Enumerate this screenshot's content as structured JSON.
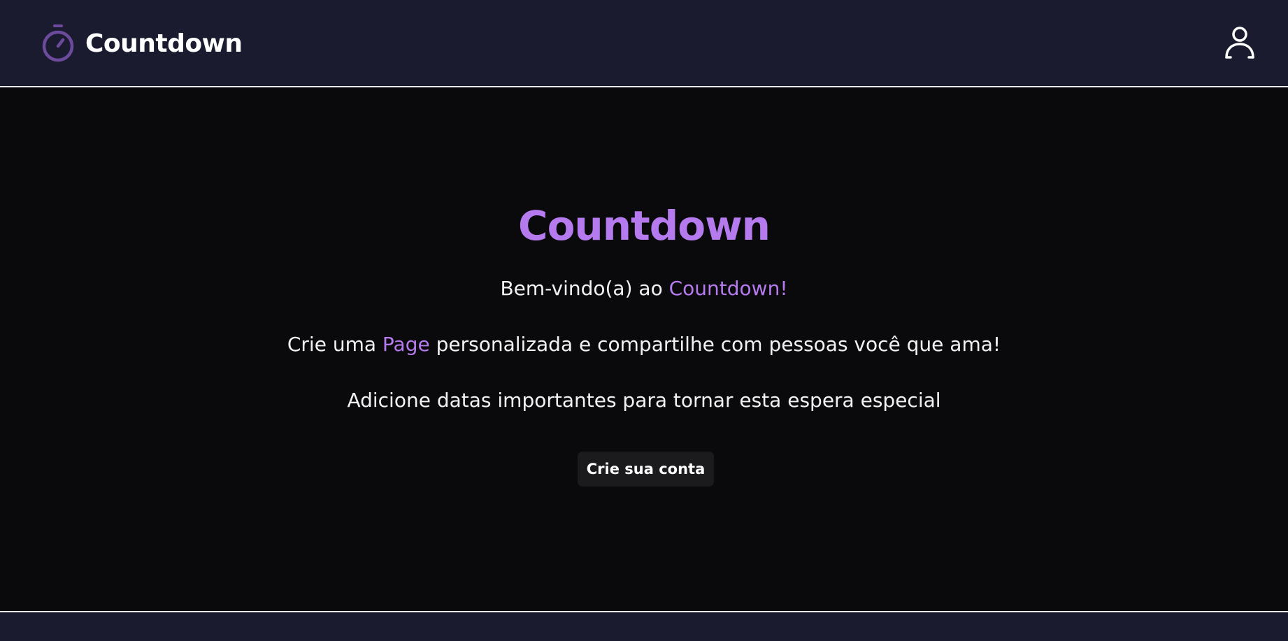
{
  "header": {
    "brand_name": "Countdown",
    "brand_icon": "stopwatch-icon",
    "user_icon": "user-icon"
  },
  "hero": {
    "title": "Countdown",
    "welcome_prefix": "Bem-vindo(a) ao ",
    "welcome_accent": "Countdown!",
    "create_prefix": "Crie uma ",
    "create_accent": "Page",
    "create_suffix": " personalizada e compartilhe com pessoas você que ama!",
    "dates_line": "Adicione datas importantes para tornar esta espera especial",
    "cta_label": "Crie sua conta"
  },
  "colors": {
    "accent": "#b57bee",
    "header_bg": "#1b1b2f",
    "main_bg": "#0a0a0c",
    "button_bg": "#1b1b1e",
    "text": "#f2f2f5"
  }
}
